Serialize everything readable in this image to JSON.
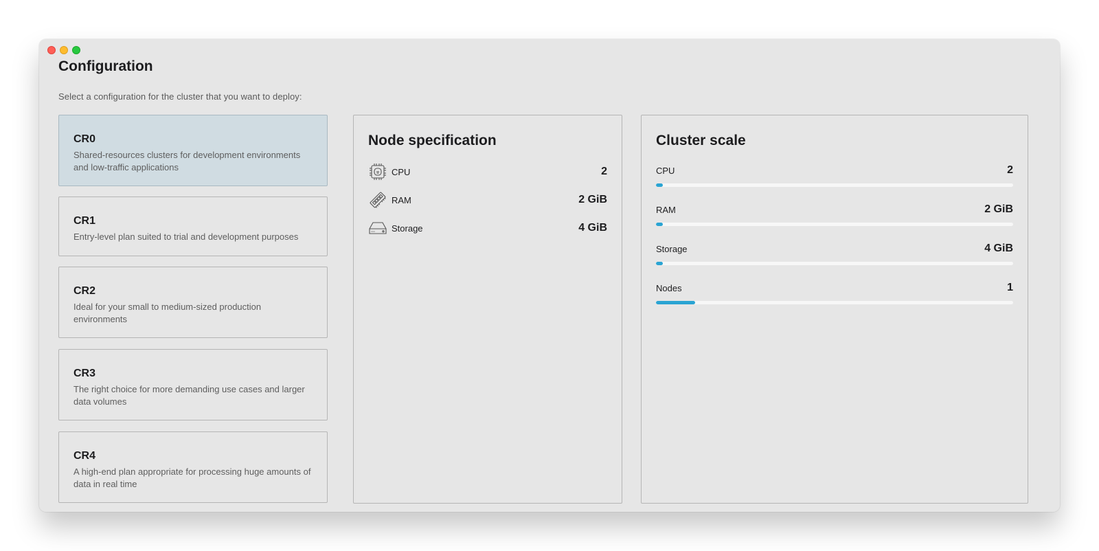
{
  "window": {
    "controls": [
      "close",
      "minimize",
      "zoom"
    ]
  },
  "header": {
    "title": "Configuration",
    "subtitle": "Select a configuration for the cluster that you want to deploy:"
  },
  "plans": [
    {
      "name": "CR0",
      "description": "Shared-resources clusters for development environments and low-traffic applications",
      "selected": true
    },
    {
      "name": "CR1",
      "description": "Entry-level plan suited to trial and development purposes",
      "selected": false
    },
    {
      "name": "CR2",
      "description": "Ideal for your small to medium-sized production environments",
      "selected": false
    },
    {
      "name": "CR3",
      "description": "The right choice for more demanding use cases and larger data volumes",
      "selected": false
    },
    {
      "name": "CR4",
      "description": "A high-end plan appropriate for processing huge amounts of data in real time",
      "selected": false
    }
  ],
  "node_spec": {
    "title": "Node specification",
    "rows": [
      {
        "icon": "cpu-icon",
        "label": "CPU",
        "value": "2"
      },
      {
        "icon": "ram-icon",
        "label": "RAM",
        "value": "2 GiB"
      },
      {
        "icon": "storage-icon",
        "label": "Storage",
        "value": "4 GiB"
      }
    ]
  },
  "cluster_scale": {
    "title": "Cluster scale",
    "rows": [
      {
        "label": "CPU",
        "value": "2",
        "fill_percent": 2
      },
      {
        "label": "RAM",
        "value": "2 GiB",
        "fill_percent": 2
      },
      {
        "label": "Storage",
        "value": "4 GiB",
        "fill_percent": 2
      },
      {
        "label": "Nodes",
        "value": "1",
        "fill_percent": 11
      }
    ]
  },
  "colors": {
    "accent": "#2aa4d3",
    "selected_card": "#d0dce2",
    "window_bg": "#e6e6e6"
  }
}
